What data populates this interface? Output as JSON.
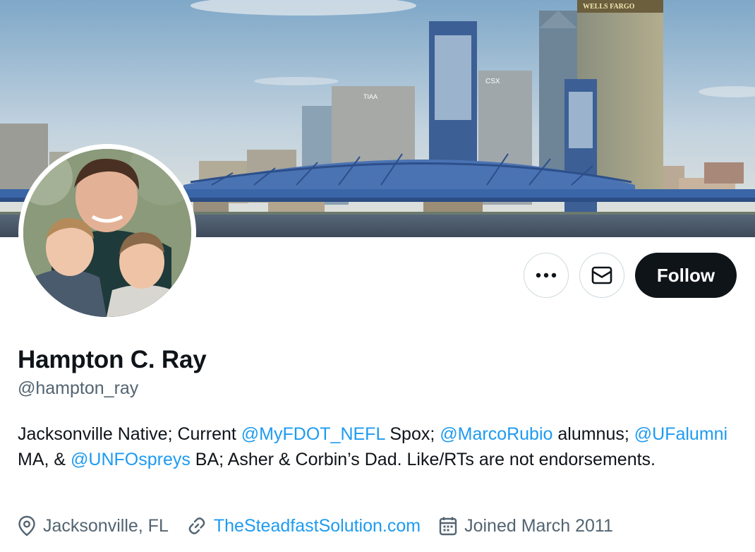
{
  "profile": {
    "name": "Hampton C. Ray",
    "handle": "@hampton_ray",
    "bio": {
      "t1": "Jacksonville Native; Current ",
      "m1": "@MyFDOT_NEFL",
      "t2": " Spox; ",
      "m2": "@MarcoRubio",
      "t3": " alumnus; ",
      "m3": "@UFalumni",
      "t4": " MA, & ",
      "m4": "@UNFOspreys",
      "t5": " BA; Asher & Corbin’s Dad. Like/RTs are not endorsements."
    },
    "location": "Jacksonville, FL",
    "website": "TheSteadfastSolution.com",
    "joined": "Joined March 2011"
  },
  "banner": {
    "building_signs": [
      "WELLS FARGO",
      "TIAA",
      "CSX"
    ]
  },
  "actions": {
    "more_icon": "ellipsis-icon",
    "message_icon": "envelope-icon",
    "follow_label": "Follow"
  },
  "colors": {
    "link": "#1d9bf0",
    "secondary_text": "#536471",
    "primary_text": "#0f1419",
    "follow_bg": "#0f1419"
  }
}
